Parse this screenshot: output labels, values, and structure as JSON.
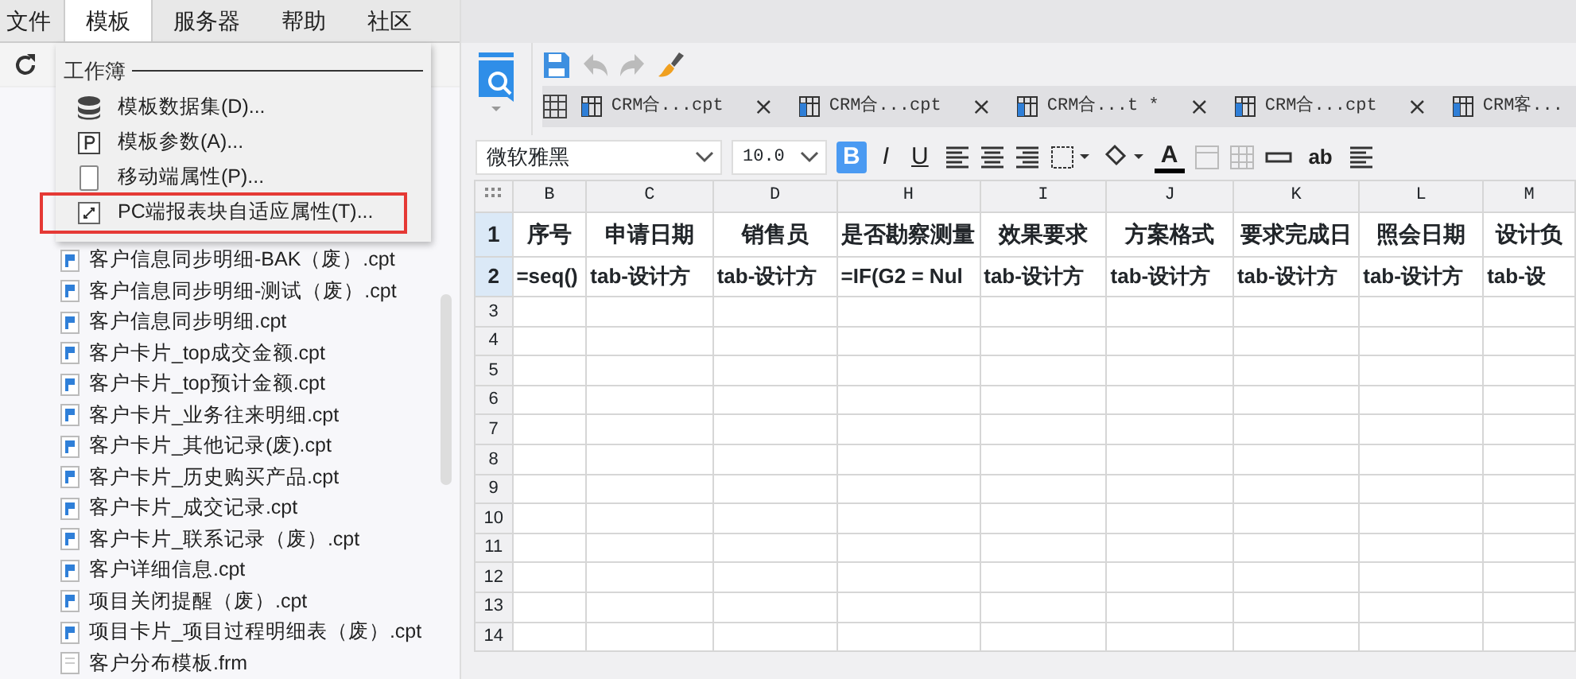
{
  "menubar": [
    {
      "label": "文件",
      "selected": false
    },
    {
      "label": "模板",
      "selected": true
    },
    {
      "label": "服务器",
      "selected": false
    },
    {
      "label": "帮助",
      "selected": false
    },
    {
      "label": "社区",
      "selected": false
    }
  ],
  "dropdown": {
    "section": "工作簿",
    "items": [
      {
        "kind": "dataset",
        "label": "模板数据集(D)...",
        "highlighted": false
      },
      {
        "kind": "parameter",
        "label": "模板参数(A)...",
        "highlighted": false
      },
      {
        "kind": "mobile",
        "label": "移动端属性(P)...",
        "highlighted": false
      },
      {
        "kind": "adaptive",
        "label": "PC端报表块自适应属性(T)...",
        "highlighted": true
      }
    ]
  },
  "tree": [
    {
      "kind": "cpt",
      "label": "客户信息同步明细-BAK（废）.cpt"
    },
    {
      "kind": "cpt",
      "label": "客户信息同步明细-测试（废）.cpt"
    },
    {
      "kind": "cpt",
      "label": "客户信息同步明细.cpt"
    },
    {
      "kind": "cpt",
      "label": "客户卡片_top成交金额.cpt"
    },
    {
      "kind": "cpt",
      "label": "客户卡片_top预计金额.cpt"
    },
    {
      "kind": "cpt",
      "label": "客户卡片_业务往来明细.cpt"
    },
    {
      "kind": "cpt",
      "label": "客户卡片_其他记录(废).cpt"
    },
    {
      "kind": "cpt",
      "label": "客户卡片_历史购买产品.cpt"
    },
    {
      "kind": "cpt",
      "label": "客户卡片_成交记录.cpt"
    },
    {
      "kind": "cpt",
      "label": "客户卡片_联系记录（废）.cpt"
    },
    {
      "kind": "cpt",
      "label": "客户详细信息.cpt"
    },
    {
      "kind": "cpt",
      "label": "项目关闭提醒（废）.cpt"
    },
    {
      "kind": "cpt",
      "label": "项目卡片_项目过程明细表（废）.cpt"
    },
    {
      "kind": "frm",
      "label": "客户分布模板.frm"
    }
  ],
  "tabs": [
    {
      "label": "CRM合...cpt",
      "close": "×"
    },
    {
      "label": "CRM合...cpt",
      "close": "×"
    },
    {
      "label": "CRM合...t *",
      "close": "×"
    },
    {
      "label": "CRM合...cpt",
      "close": "×"
    },
    {
      "label": "CRM客..."
    }
  ],
  "format": {
    "font": "微软雅黑",
    "size": "10.0",
    "bold": true,
    "italic": false,
    "underline": false,
    "underline_label": "U",
    "bold_label": "B",
    "italic_label": "I",
    "color_label": "A",
    "wrap_label": "ab"
  },
  "grid": {
    "columns": [
      "B",
      "C",
      "D",
      "H",
      "I",
      "J",
      "K",
      "L",
      "M"
    ],
    "rows": [
      {
        "number": "1",
        "selected": true,
        "cells": [
          "序号",
          "申请日期",
          "销售员",
          "是否勘察测量",
          "效果要求",
          "方案格式",
          "要求完成日",
          "照会日期",
          "设计负"
        ]
      },
      {
        "number": "2",
        "selected": true,
        "cells": [
          "=seq()",
          "tab-设计方",
          "tab-设计方",
          "=IF(G2 = Nul",
          "tab-设计方",
          "tab-设计方",
          "tab-设计方",
          "tab-设计方",
          "tab-设"
        ]
      },
      {
        "number": "3",
        "selected": false,
        "cells": []
      },
      {
        "number": "4",
        "selected": false,
        "cells": []
      },
      {
        "number": "5",
        "selected": false,
        "cells": []
      },
      {
        "number": "6",
        "selected": false,
        "cells": []
      },
      {
        "number": "7",
        "selected": false,
        "cells": []
      },
      {
        "number": "8",
        "selected": false,
        "cells": []
      },
      {
        "number": "9",
        "selected": false,
        "cells": []
      },
      {
        "number": "10",
        "selected": false,
        "cells": []
      },
      {
        "number": "11",
        "selected": false,
        "cells": []
      },
      {
        "number": "12",
        "selected": false,
        "cells": []
      },
      {
        "number": "13",
        "selected": false,
        "cells": []
      },
      {
        "number": "14",
        "selected": false,
        "cells": []
      }
    ]
  }
}
